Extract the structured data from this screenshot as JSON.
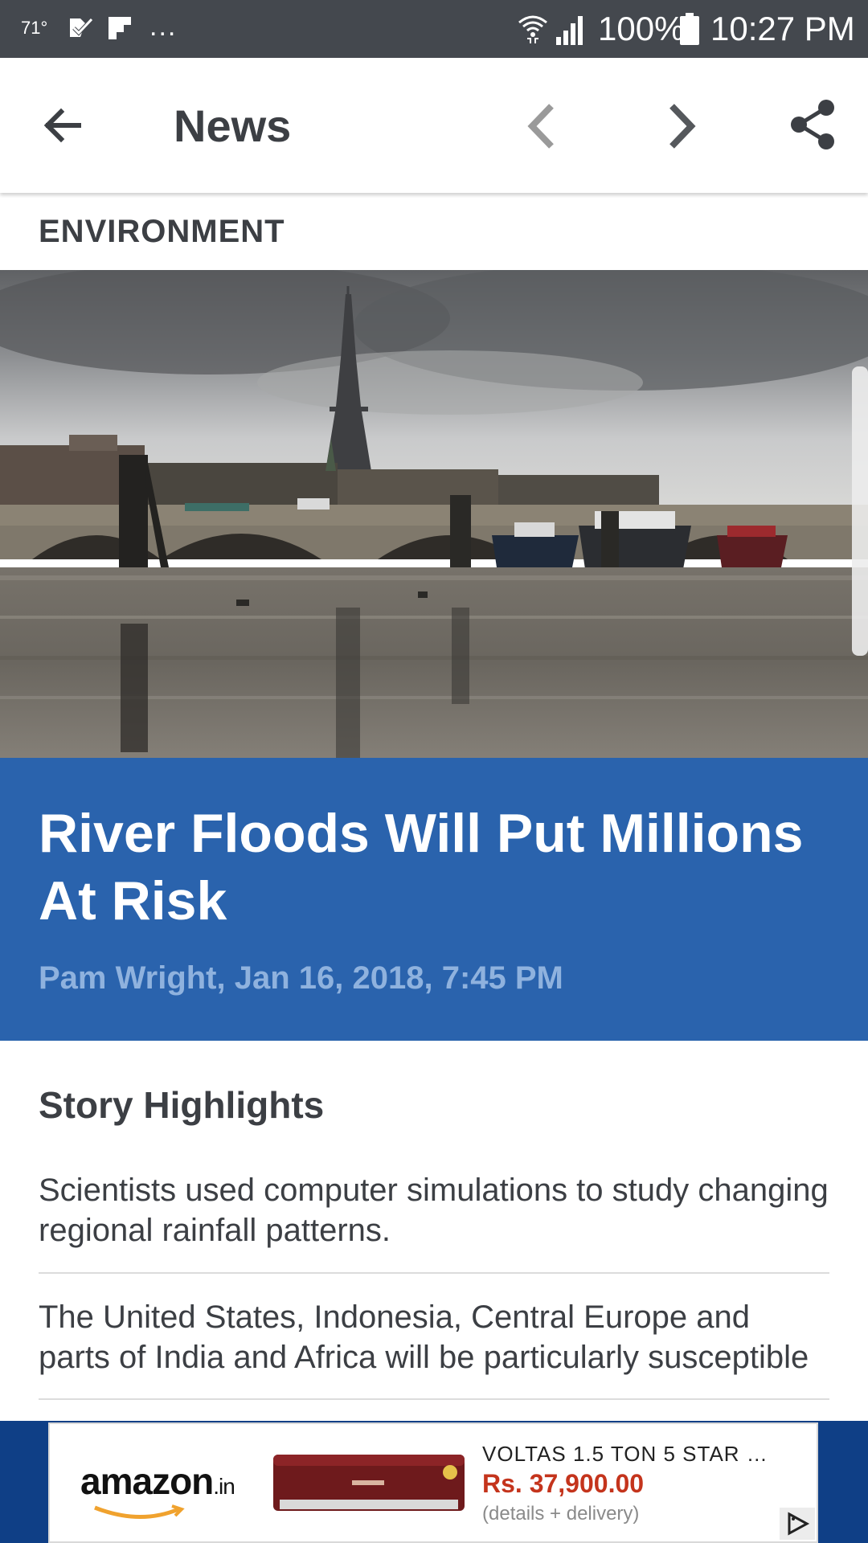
{
  "status_bar": {
    "temperature": "71°",
    "dots": "...",
    "battery_percent": "100%",
    "time": "10:27 PM",
    "icons": [
      "checkmark-notification-icon",
      "flipboard-icon",
      "wifi-icon",
      "signal-icon",
      "battery-icon"
    ]
  },
  "app_bar": {
    "title": "News",
    "icons": [
      "back-arrow-icon",
      "chevron-left-icon",
      "chevron-right-icon",
      "share-icon"
    ]
  },
  "article": {
    "category": "ENVIRONMENT",
    "headline": "River Floods Will Put Millions At Risk",
    "byline": "Pam Wright, Jan 16, 2018, 7:45 PM"
  },
  "highlights": {
    "title": "Story Highlights",
    "items": [
      "Scientists used computer simulations to study changing regional rainfall patterns.",
      "The United States, Indonesia, Central Europe and parts of India and Africa will be particularly susceptible"
    ]
  },
  "ad": {
    "brand": "amazon",
    "brand_suffix": ".in",
    "product_name": "VOLTAS 1.5 TON 5 STAR …",
    "price": "Rs. 37,900.00",
    "subtext": "(details + delivery)",
    "icons": [
      "ad-choices-icon"
    ]
  },
  "colors": {
    "status_bar_bg": "#44484e",
    "headline_bg": "#2a63ad",
    "byline_text": "#8fb2de",
    "price_text": "#c4341c",
    "ad_bg": "#0f3f86"
  }
}
